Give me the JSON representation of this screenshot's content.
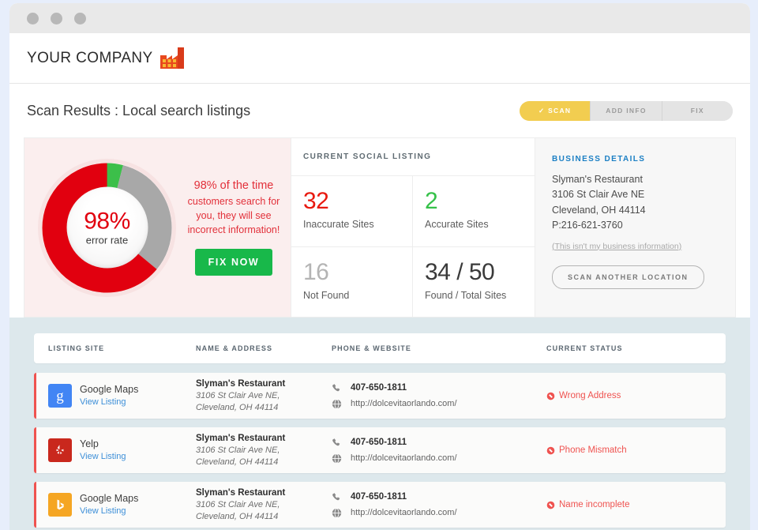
{
  "window": {
    "dots": [
      "close-dot",
      "minimize-dot",
      "maximize-dot"
    ]
  },
  "brand": {
    "name": "YOUR COMPANY",
    "logo_icon": "factory-icon"
  },
  "header": {
    "page_title": "Scan Results : Local search listings",
    "tabs": [
      {
        "label": "SCAN",
        "active": true,
        "check": "✓"
      },
      {
        "label": "ADD INFO",
        "active": false
      },
      {
        "label": "FIX",
        "active": false
      }
    ]
  },
  "summary": {
    "donut": {
      "percent_text": "98%",
      "label": "error rate",
      "headline": "98% of the time",
      "subline": "customers search for you, they will see incorrect information!",
      "cta_label": "FIX NOW"
    },
    "stats": {
      "title": "CURRENT SOCIAL LISTING",
      "items": [
        {
          "value": "32",
          "caption": "Inaccurate Sites",
          "color": "#e8190f"
        },
        {
          "value": "2",
          "caption": "Accurate Sites",
          "color": "#35c149"
        },
        {
          "value": "16",
          "caption": "Not Found",
          "color": "#b4b4b4"
        },
        {
          "value": "34 / 50",
          "caption": "Found / Total Sites",
          "color": "#3a3a3a"
        }
      ]
    },
    "details": {
      "title": "BUSINESS DETAILS",
      "business_name": "Slyman's Restaurant",
      "street": "3106 St Clair Ave NE",
      "city_state_zip": "Cleveland, OH 44114",
      "phone": "P:216-621-3760",
      "disclaimer_link": "(This isn't my business information)",
      "scan_button": "SCAN ANOTHER LOCATION"
    }
  },
  "listings": {
    "columns": [
      "LISTING SITE",
      "NAME & ADDRESS",
      "PHONE & WEBSITE",
      "CURRENT STATUS"
    ],
    "view_listing_label": "View Listing",
    "rows": [
      {
        "site": "Google Maps",
        "icon": "google-icon",
        "icon_letter": "g",
        "icon_bg": "#4285f4",
        "name": "Slyman's Restaurant",
        "address_line1": "3106 St Clair Ave NE,",
        "address_line2": "Cleveland, OH 44114",
        "phone": "407-650-1811",
        "website": "http://dolcevitaorlando.com/",
        "status": "Wrong Address"
      },
      {
        "site": "Yelp",
        "icon": "yelp-icon",
        "icon_letter": "",
        "icon_bg": "#c9281d",
        "name": "Slyman's Restaurant",
        "address_line1": "3106 St Clair Ave NE,",
        "address_line2": "Cleveland, OH 44114",
        "phone": "407-650-1811",
        "website": "http://dolcevitaorlando.com/",
        "status": "Phone Mismatch"
      },
      {
        "site": "Google Maps",
        "icon": "bing-icon",
        "icon_letter": "b",
        "icon_bg": "#f5a623",
        "name": "Slyman's Restaurant",
        "address_line1": "3106 St Clair Ave NE,",
        "address_line2": "Cleveland, OH 44114",
        "phone": "407-650-1811",
        "website": "http://dolcevitaorlando.com/",
        "status": "Name incomplete"
      }
    ]
  },
  "chart_data": {
    "type": "pie",
    "title": "Listing accuracy",
    "categories": [
      "Inaccurate Sites",
      "Not Found",
      "Accurate Sites"
    ],
    "values": [
      32,
      16,
      2
    ],
    "percentages": [
      64,
      32,
      4
    ],
    "colors": [
      "#e1000f",
      "#a8a8a8",
      "#3cbf4a"
    ],
    "center_label": "98%",
    "center_sublabel": "error rate",
    "total": 50,
    "legend": "off",
    "donut_hole": 0.59
  }
}
